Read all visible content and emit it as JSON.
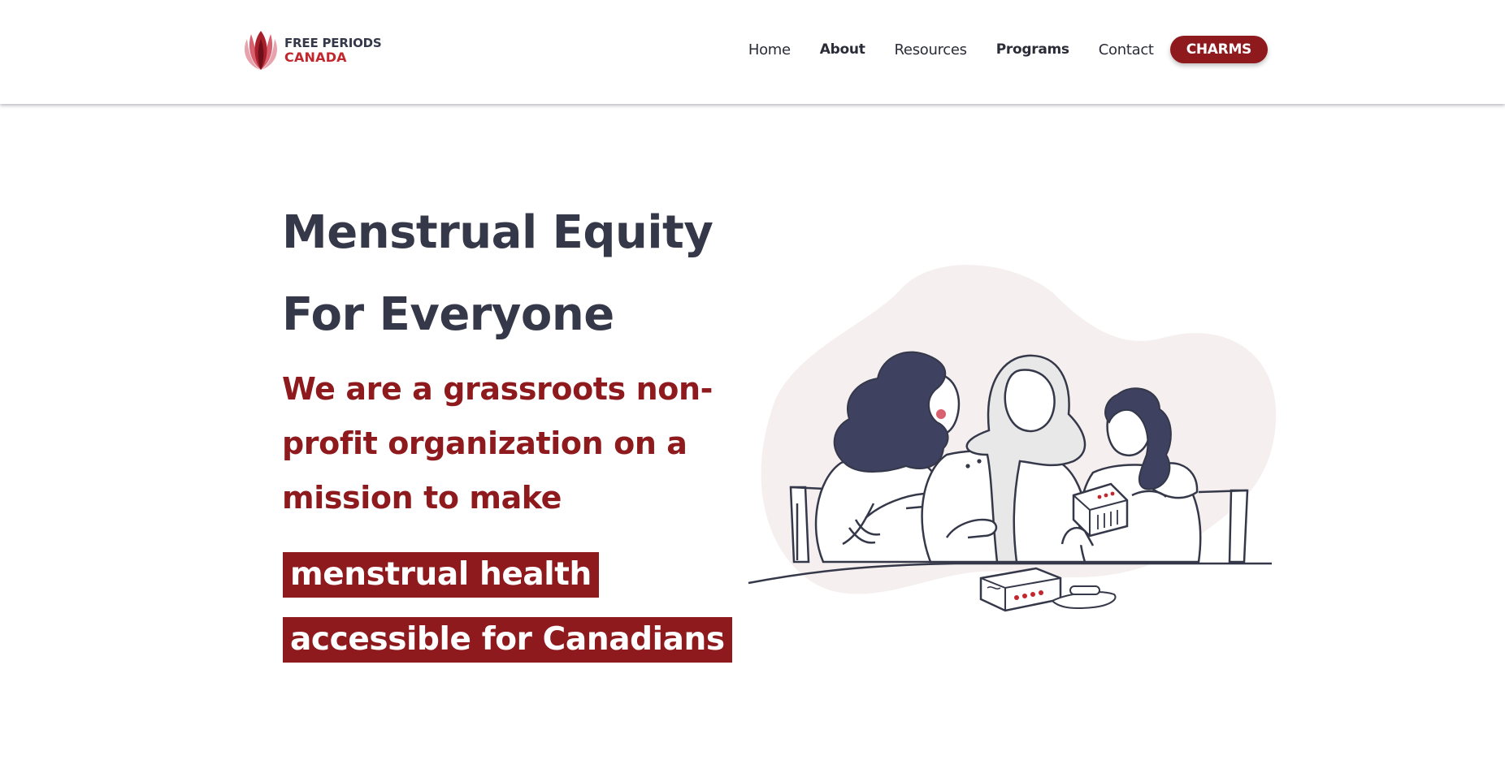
{
  "header": {
    "logo": {
      "line1": "FREE PERIODS",
      "line2": "CANADA"
    },
    "nav": [
      {
        "label": "Home"
      },
      {
        "label": "About"
      },
      {
        "label": "Resources"
      },
      {
        "label": "Programs"
      },
      {
        "label": "Contact"
      }
    ],
    "cta_label": "CHARMS"
  },
  "hero": {
    "title_line1": "Menstrual Equity",
    "title_line2": "For Everyone",
    "subtitle_line1": "We are a grassroots non-",
    "subtitle_line2": "profit organization on a",
    "subtitle_line3": "mission to make",
    "highlight_line1": "menstrual health",
    "highlight_line2": "accessible for Canadians"
  },
  "colors": {
    "brand_red": "#8e1a1d",
    "logo_red": "#c1272d",
    "text_dark": "#353849",
    "blob": "#f5efef"
  },
  "icons": {
    "logo": "tulip-logo-icon"
  }
}
